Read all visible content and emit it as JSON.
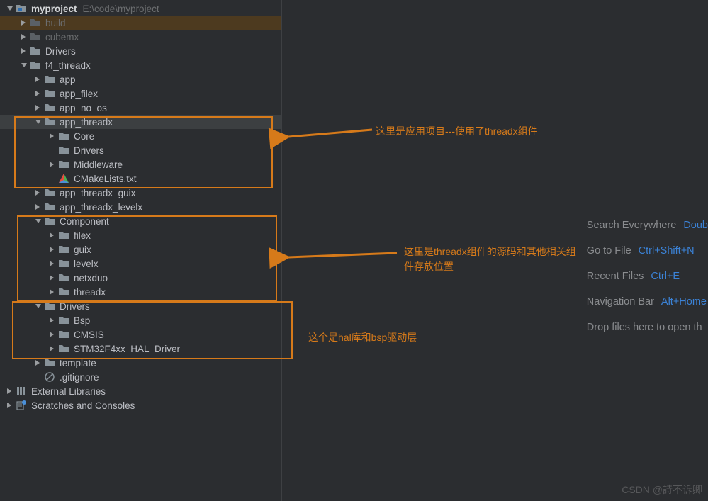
{
  "root": {
    "name": "myproject",
    "path": "E:\\code\\myproject"
  },
  "tree": {
    "build": "build",
    "cubemx": "cubemx",
    "drivers": "Drivers",
    "f4_threadx": "f4_threadx",
    "app": "app",
    "app_filex": "app_filex",
    "app_no_os": "app_no_os",
    "app_threadx": "app_threadx",
    "core": "Core",
    "drivers2": "Drivers",
    "middleware": "Middleware",
    "cmakelists": "CMakeLists.txt",
    "app_threadx_guix": "app_threadx_guix",
    "app_threadx_levelx": "app_threadx_levelx",
    "component": "Component",
    "filex": "filex",
    "guix": "guix",
    "levelx": "levelx",
    "netxduo": "netxduo",
    "threadx": "threadx",
    "drivers3": "Drivers",
    "bsp": "Bsp",
    "cmsis": "CMSIS",
    "hal_driver": "STM32F4xx_HAL_Driver",
    "template": "template",
    "gitignore": ".gitignore",
    "external_libraries": "External Libraries",
    "scratches": "Scratches and Consoles"
  },
  "annotations": {
    "a1": "这里是应用项目---使用了threadx组件",
    "a2": "这里是threadx组件的源码和其他相关组件存放位置",
    "a3": "这个是hal库和bsp驱动层"
  },
  "help": {
    "search": {
      "label": "Search Everywhere",
      "key": "Doub"
    },
    "goto": {
      "label": "Go to File",
      "key": "Ctrl+Shift+N"
    },
    "recent": {
      "label": "Recent Files",
      "key": "Ctrl+E"
    },
    "nav": {
      "label": "Navigation Bar",
      "key": "Alt+Home"
    },
    "drop": {
      "label": "Drop files here to open th"
    }
  },
  "watermark": "CSDN @詩不诉卿"
}
